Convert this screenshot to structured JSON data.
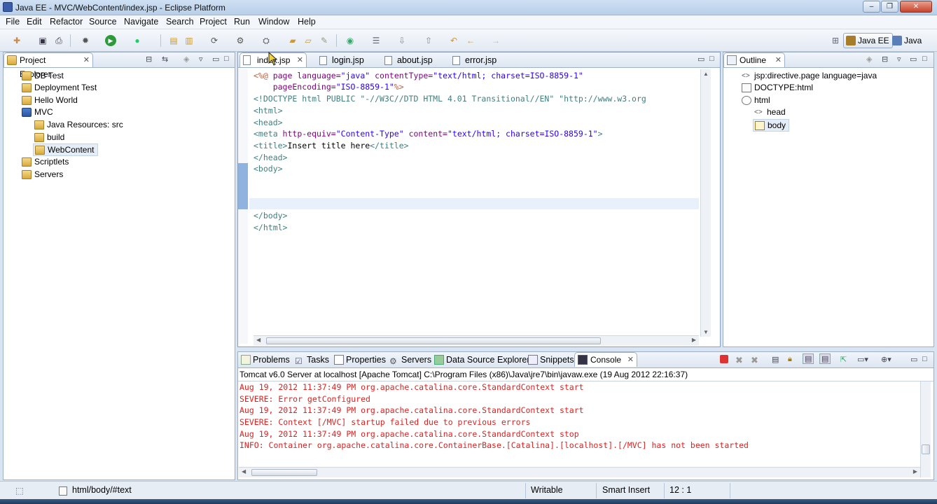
{
  "window": {
    "title": "Java EE - MVC/WebContent/index.jsp - Eclipse Platform"
  },
  "menu": [
    "File",
    "Edit",
    "Refactor",
    "Source",
    "Navigate",
    "Search",
    "Project",
    "Run",
    "Window",
    "Help"
  ],
  "perspectives": [
    {
      "label": "Java EE",
      "active": true
    },
    {
      "label": "Java",
      "active": false
    }
  ],
  "project_explorer": {
    "title": "Project Explorer",
    "items": [
      {
        "label": "DB Test",
        "icon": "project-icon"
      },
      {
        "label": "Deployment Test",
        "icon": "project-icon"
      },
      {
        "label": "Hello World",
        "icon": "project-icon"
      },
      {
        "label": "MVC",
        "icon": "project-icon"
      },
      {
        "label": "Java Resources: src",
        "icon": "java-resources-icon"
      },
      {
        "label": "build",
        "icon": "folder-icon"
      },
      {
        "label": "WebContent",
        "icon": "folder-icon",
        "selected": true
      },
      {
        "label": "Scriptlets",
        "icon": "project-icon"
      },
      {
        "label": "Servers",
        "icon": "folder-icon"
      }
    ]
  },
  "editor": {
    "tabs": [
      {
        "label": "index.jsp",
        "active": true
      },
      {
        "label": "login.jsp",
        "active": false
      },
      {
        "label": "about.jsp",
        "active": false
      },
      {
        "label": "error.jsp",
        "active": false
      }
    ],
    "lines": [
      [
        "<%@",
        " page",
        " language=",
        "\"java\"",
        " contentType=",
        "\"text/html; charset=ISO-8859-1\""
      ],
      [
        "    pageEncoding=",
        "\"ISO-8859-1\"",
        "%>"
      ],
      [
        "<!DOCTYPE html PUBLIC \"-//W3C//DTD HTML 4.01 Transitional//EN\" \"http://www.w3.org"
      ],
      [
        "<html>"
      ],
      [
        "<head>"
      ],
      [
        "<meta",
        " http-equiv=",
        "\"Content-Type\"",
        " content=",
        "\"text/html; charset=ISO-8859-1\"",
        ">"
      ],
      [
        "<title>",
        "Insert title here",
        "</title>"
      ],
      [
        "</head>"
      ],
      [
        "<body>"
      ],
      [
        ""
      ],
      [
        ""
      ],
      [
        ""
      ],
      [
        "</body>"
      ],
      [
        "</html>"
      ]
    ]
  },
  "outline": {
    "title": "Outline",
    "items": [
      {
        "label": "jsp:directive.page language=java",
        "icon": "directive-icon"
      },
      {
        "label": "DOCTYPE:html",
        "icon": "doctype-icon"
      },
      {
        "label": "html",
        "icon": "element-icon"
      },
      {
        "label": "head",
        "icon": "element-icon"
      },
      {
        "label": "body",
        "icon": "element-icon",
        "selected": true
      }
    ]
  },
  "bottom_tabs": [
    "Problems",
    "Tasks",
    "Properties",
    "Servers",
    "Data Source Explorer",
    "Snippets",
    "Console"
  ],
  "console": {
    "header": "Tomcat v6.0 Server at localhost [Apache Tomcat] C:\\Program Files (x86)\\Java\\jre7\\bin\\javaw.exe (19 Aug 2012 22:16:37)",
    "lines": [
      "Aug 19, 2012 11:37:49 PM org.apache.catalina.core.StandardContext start",
      "SEVERE: Error getConfigured",
      "Aug 19, 2012 11:37:49 PM org.apache.catalina.core.StandardContext start",
      "SEVERE: Context [/MVC] startup failed due to previous errors",
      "Aug 19, 2012 11:37:49 PM org.apache.catalina.core.StandardContext stop",
      "INFO: Container org.apache.catalina.core.ContainerBase.[Catalina].[localhost].[/MVC] has not been started"
    ]
  },
  "status": {
    "path": "html/body/#text",
    "mode": "Writable",
    "insert": "Smart Insert",
    "position": "12 : 1"
  }
}
